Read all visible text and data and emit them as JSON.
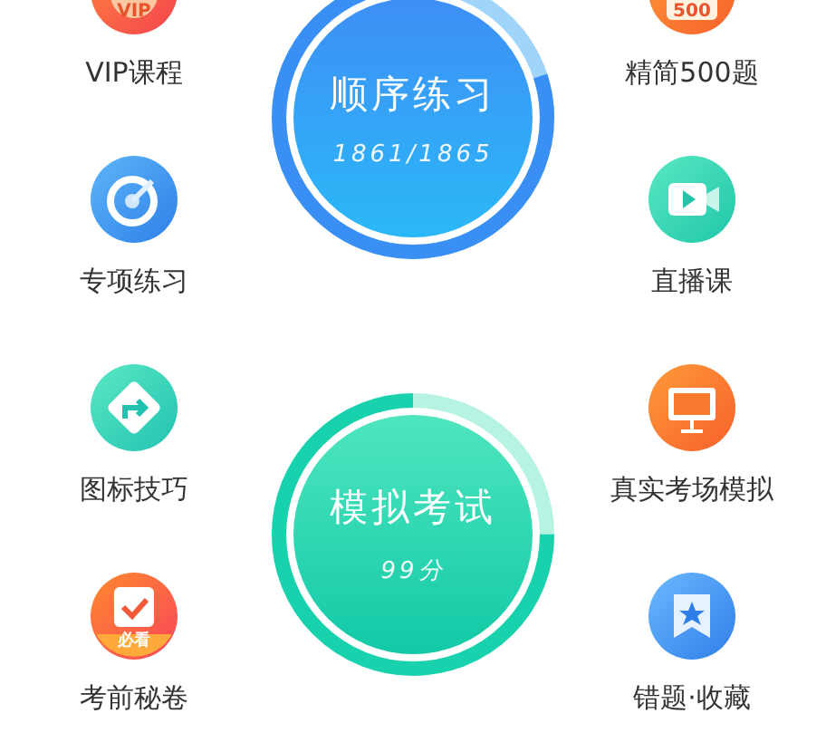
{
  "left_items": [
    {
      "label": "VIP课程",
      "badge": "VIP"
    },
    {
      "label": "专项练习"
    },
    {
      "label": "图标技巧"
    },
    {
      "label": "考前秘卷",
      "badge": "必看"
    }
  ],
  "right_items": [
    {
      "label": "精简500题",
      "badge": "500"
    },
    {
      "label": "直播课"
    },
    {
      "label": "真实考场模拟"
    },
    {
      "label": "错题·收藏"
    }
  ],
  "circles": [
    {
      "title": "顺序练习",
      "reading": "1861/1865",
      "kind": "blue"
    },
    {
      "title": "模拟考试",
      "reading": "99分",
      "kind": "green"
    }
  ]
}
